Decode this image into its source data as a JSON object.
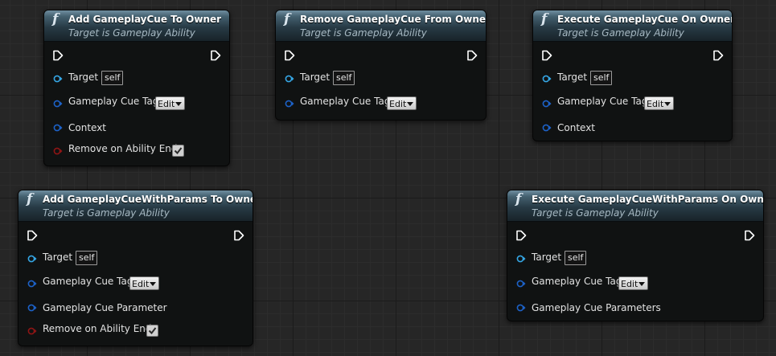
{
  "icon": "function-f-icon",
  "colors": {
    "header": "#2f4653",
    "body": "#101212",
    "object_pin": "#35a7e6",
    "struct_pin": "#1d62c8",
    "bool_pin": "#8f1515",
    "exec_pin": "#ffffff"
  },
  "nodes": {
    "add_cue": {
      "title": "Add GameplayCue To Owner",
      "subtitle": "Target is Gameplay Ability",
      "target_label": "Target",
      "target_default": "self",
      "tag_label": "Gameplay Cue Tag",
      "edit_label": "Edit",
      "context_label": "Context",
      "remove_label": "Remove on Ability End",
      "remove_checked": true
    },
    "remove_cue": {
      "title": "Remove GameplayCue From Owner",
      "subtitle": "Target is Gameplay Ability",
      "target_label": "Target",
      "target_default": "self",
      "tag_label": "Gameplay Cue Tag",
      "edit_label": "Edit"
    },
    "execute_cue": {
      "title": "Execute GameplayCue On Owner",
      "subtitle": "Target is Gameplay Ability",
      "target_label": "Target",
      "target_default": "self",
      "tag_label": "Gameplay Cue Tag",
      "edit_label": "Edit",
      "context_label": "Context"
    },
    "add_cue_params": {
      "title": "Add GameplayCueWithParams To Owner",
      "subtitle": "Target is Gameplay Ability",
      "target_label": "Target",
      "target_default": "self",
      "tag_label": "Gameplay Cue Tag",
      "edit_label": "Edit",
      "param_label": "Gameplay Cue Parameter",
      "remove_label": "Remove on Ability End",
      "remove_checked": true
    },
    "execute_cue_params": {
      "title": "Execute GameplayCueWithParams On Owner",
      "subtitle": "Target is Gameplay Ability",
      "target_label": "Target",
      "target_default": "self",
      "tag_label": "Gameplay Cue Tag",
      "edit_label": "Edit",
      "param_label": "Gameplay Cue Parameters"
    }
  }
}
